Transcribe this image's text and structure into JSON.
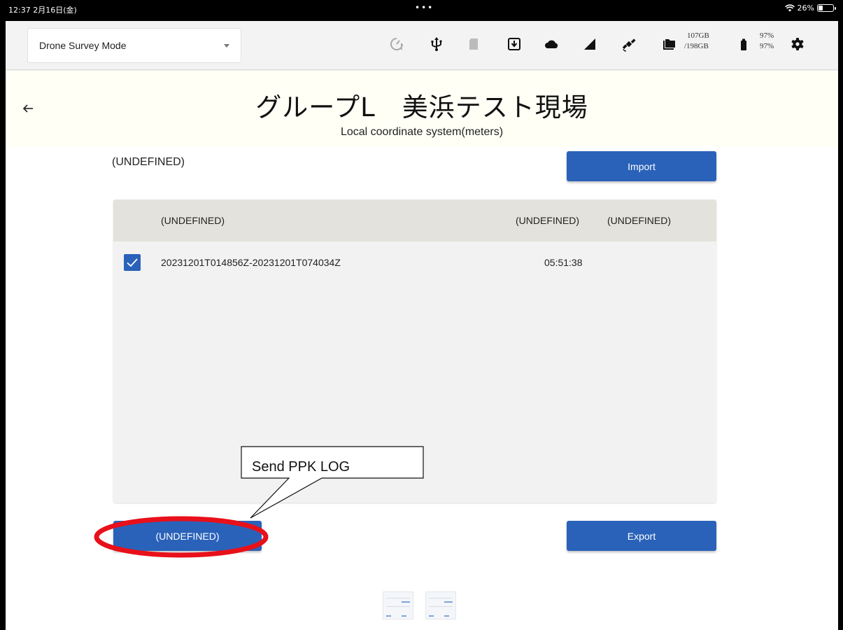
{
  "status_bar": {
    "time": "12:37  2月16日(金)",
    "dots": "•••",
    "wifi_battery": "26%"
  },
  "toolbar": {
    "mode_select": "Drone Survey Mode",
    "storage_used": "107GB",
    "storage_total": "/198GB",
    "percent_top": "97%",
    "percent_bottom": "97%",
    "icons": [
      "timer-icon",
      "usb-icon",
      "sd-card-icon",
      "download-box-icon",
      "cloud-icon",
      "signal-icon",
      "satellite-icon",
      "folder-icon",
      "battery-icon",
      "gear-icon"
    ]
  },
  "header": {
    "title": "グループL　美浜テスト現場",
    "subtitle": "Local coordinate system(meters)"
  },
  "main": {
    "section_label": "(UNDEFINED)",
    "import_label": "Import",
    "export_label": "Export",
    "send_label": "(UNDEFINED)",
    "table": {
      "columns": [
        "(UNDEFINED)",
        "(UNDEFINED)",
        "(UNDEFINED)"
      ],
      "rows": [
        {
          "checked": true,
          "name": "20231201T014856Z-20231201T074034Z",
          "time": "05:51:38",
          "extra": ""
        }
      ]
    }
  },
  "annotation": {
    "callout_text": "Send PPK LOG",
    "highlight_color": "#e8101a"
  },
  "colors": {
    "accent": "#2a62b9",
    "header_bg": "#fffff6",
    "table_header_bg": "#e4e2dc"
  }
}
